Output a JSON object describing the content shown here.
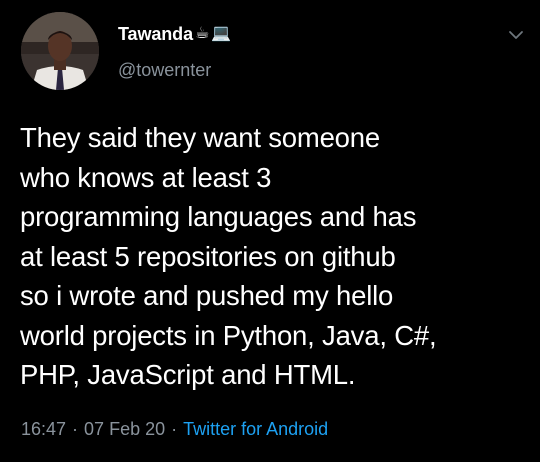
{
  "tweet": {
    "display_name": "Tawanda",
    "name_emoji_coffee": "☕",
    "name_emoji_laptop": "💻",
    "handle": "@towernter",
    "text": "They said they want someone\nwho knows at least 3\nprogramming languages and has\nat least 5 repositories on github\nso i wrote and pushed my hello\nworld projects in Python, Java, C#,\nPHP, JavaScript and HTML.",
    "time": "16:47",
    "separator": "·",
    "date": "07 Feb 20",
    "source": "Twitter for Android"
  },
  "icons": {
    "menu": "chevron-down-icon",
    "avatar": "avatar"
  },
  "colors": {
    "background": "#000000",
    "text": "#ffffff",
    "muted": "#8a939c",
    "link": "#1da1f2"
  }
}
